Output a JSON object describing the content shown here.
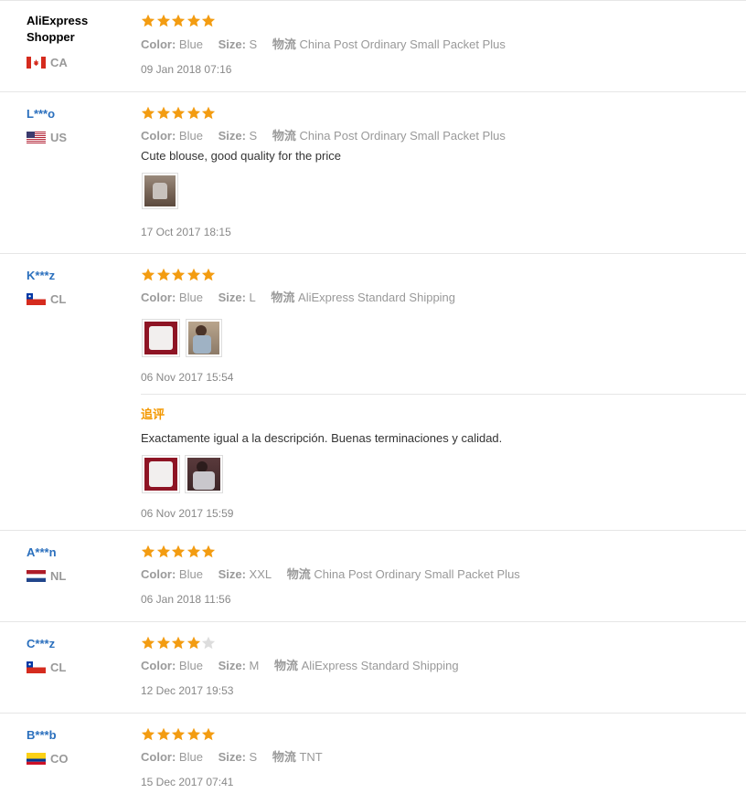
{
  "labels": {
    "color": "Color:",
    "size": "Size:",
    "logistics": "物流",
    "followup": "追评"
  },
  "colors": {
    "star_filled": "#f39c11",
    "star_empty": "#dddddd",
    "name_link": "#2a6fbd",
    "followup": "#f39800"
  },
  "reviews": [
    {
      "name": "AliExpress Shopper",
      "country": "CA",
      "flag_icon": "canada-flag-icon",
      "rating": 5,
      "color": "Blue",
      "size": "S",
      "shipping": "China Post Ordinary Small Packet Plus",
      "date": "09 Jan 2018 07:16"
    },
    {
      "name": "L***o",
      "country": "US",
      "flag_icon": "usa-flag-icon",
      "rating": 5,
      "color": "Blue",
      "size": "S",
      "shipping": "China Post Ordinary Small Packet Plus",
      "comment": "Cute blouse, good quality for the price",
      "date": "17 Oct 2017 18:15"
    },
    {
      "name": "K***z",
      "country": "CL",
      "flag_icon": "chile-flag-icon",
      "rating": 5,
      "color": "Blue",
      "size": "L",
      "shipping": "AliExpress Standard Shipping",
      "date": "06 Nov 2017 15:54",
      "followup": {
        "comment": "Exactamente igual a la descripción. Buenas terminaciones y calidad.",
        "date": "06 Nov 2017 15:59"
      }
    },
    {
      "name": "A***n",
      "country": "NL",
      "flag_icon": "netherlands-flag-icon",
      "rating": 5,
      "color": "Blue",
      "size": "XXL",
      "shipping": "China Post Ordinary Small Packet Plus",
      "date": "06 Jan 2018 11:56"
    },
    {
      "name": "C***z",
      "country": "CL",
      "flag_icon": "chile-flag-icon",
      "rating": 4,
      "color": "Blue",
      "size": "M",
      "shipping": "AliExpress Standard Shipping",
      "date": "12 Dec 2017 19:53"
    },
    {
      "name": "B***b",
      "country": "CO",
      "flag_icon": "colombia-flag-icon",
      "rating": 5,
      "color": "Blue",
      "size": "S",
      "shipping": "TNT",
      "date": "15 Dec 2017 07:41"
    }
  ]
}
